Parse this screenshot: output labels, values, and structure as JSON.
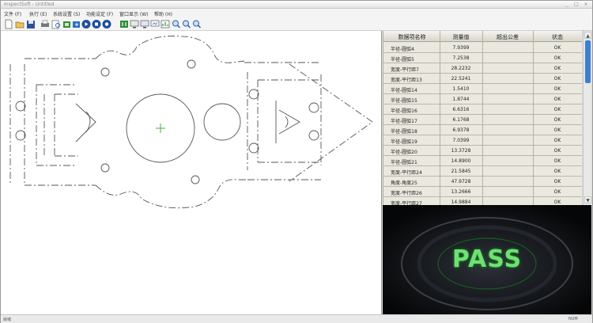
{
  "window": {
    "title": "InspectSoft - Untitled"
  },
  "menu": [
    "文件 (F)",
    "执行 (E)",
    "系统设置 (S)",
    "功能设定 (F)",
    "窗口显示 (W)",
    "帮助 (H)"
  ],
  "toolbar_icons": [
    "new-file-icon",
    "open-folder-icon",
    "save-icon",
    "print-icon",
    "print-preview-icon",
    "import-icon",
    "export-icon",
    "play-icon",
    "stop-icon",
    "record-icon",
    "pause-icon",
    "screen-icon",
    "monitor-icon",
    "display-icon",
    "chart-icon",
    "zoom-in-icon",
    "zoom-out-icon",
    "zoom-fit-icon"
  ],
  "table": {
    "headers": [
      "数据项名称",
      "测量值",
      "超出公差",
      "状态"
    ],
    "rows": [
      {
        "name": "半径-圆弧4",
        "value": "7.9399",
        "over": "",
        "status": "OK"
      },
      {
        "name": "半径-圆弧5",
        "value": "7.2538",
        "over": "",
        "status": "OK"
      },
      {
        "name": "宽度-平行距7",
        "value": "28.2232",
        "over": "",
        "status": "OK"
      },
      {
        "name": "宽度-平行距13",
        "value": "22.5241",
        "over": "",
        "status": "OK"
      },
      {
        "name": "半径-圆弧14",
        "value": "1.5410",
        "over": "",
        "status": "OK"
      },
      {
        "name": "半径-圆弧15",
        "value": "1.8744",
        "over": "",
        "status": "OK"
      },
      {
        "name": "半径-圆弧16",
        "value": "6.6316",
        "over": "",
        "status": "OK"
      },
      {
        "name": "半径-圆弧17",
        "value": "6.1768",
        "over": "",
        "status": "OK"
      },
      {
        "name": "半径-圆弧18",
        "value": "6.9378",
        "over": "",
        "status": "OK"
      },
      {
        "name": "半径-圆弧19",
        "value": "7.0399",
        "over": "",
        "status": "OK"
      },
      {
        "name": "半径-圆弧20",
        "value": "13.3728",
        "over": "",
        "status": "OK"
      },
      {
        "name": "半径-圆弧21",
        "value": "14.8900",
        "over": "",
        "status": "OK"
      },
      {
        "name": "宽度-平行距24",
        "value": "21.5845",
        "over": "",
        "status": "OK"
      },
      {
        "name": "角度-角度25",
        "value": "47.9728",
        "over": "",
        "status": "OK"
      },
      {
        "name": "宽度-平行距26",
        "value": "13.2666",
        "over": "",
        "status": "OK"
      },
      {
        "name": "宽度-平行距27",
        "value": "14.9884",
        "over": "",
        "status": "OK"
      }
    ]
  },
  "result": {
    "text": "PASS",
    "color": "#6fe073"
  },
  "status": {
    "left": "就绪",
    "right": "NUM"
  }
}
